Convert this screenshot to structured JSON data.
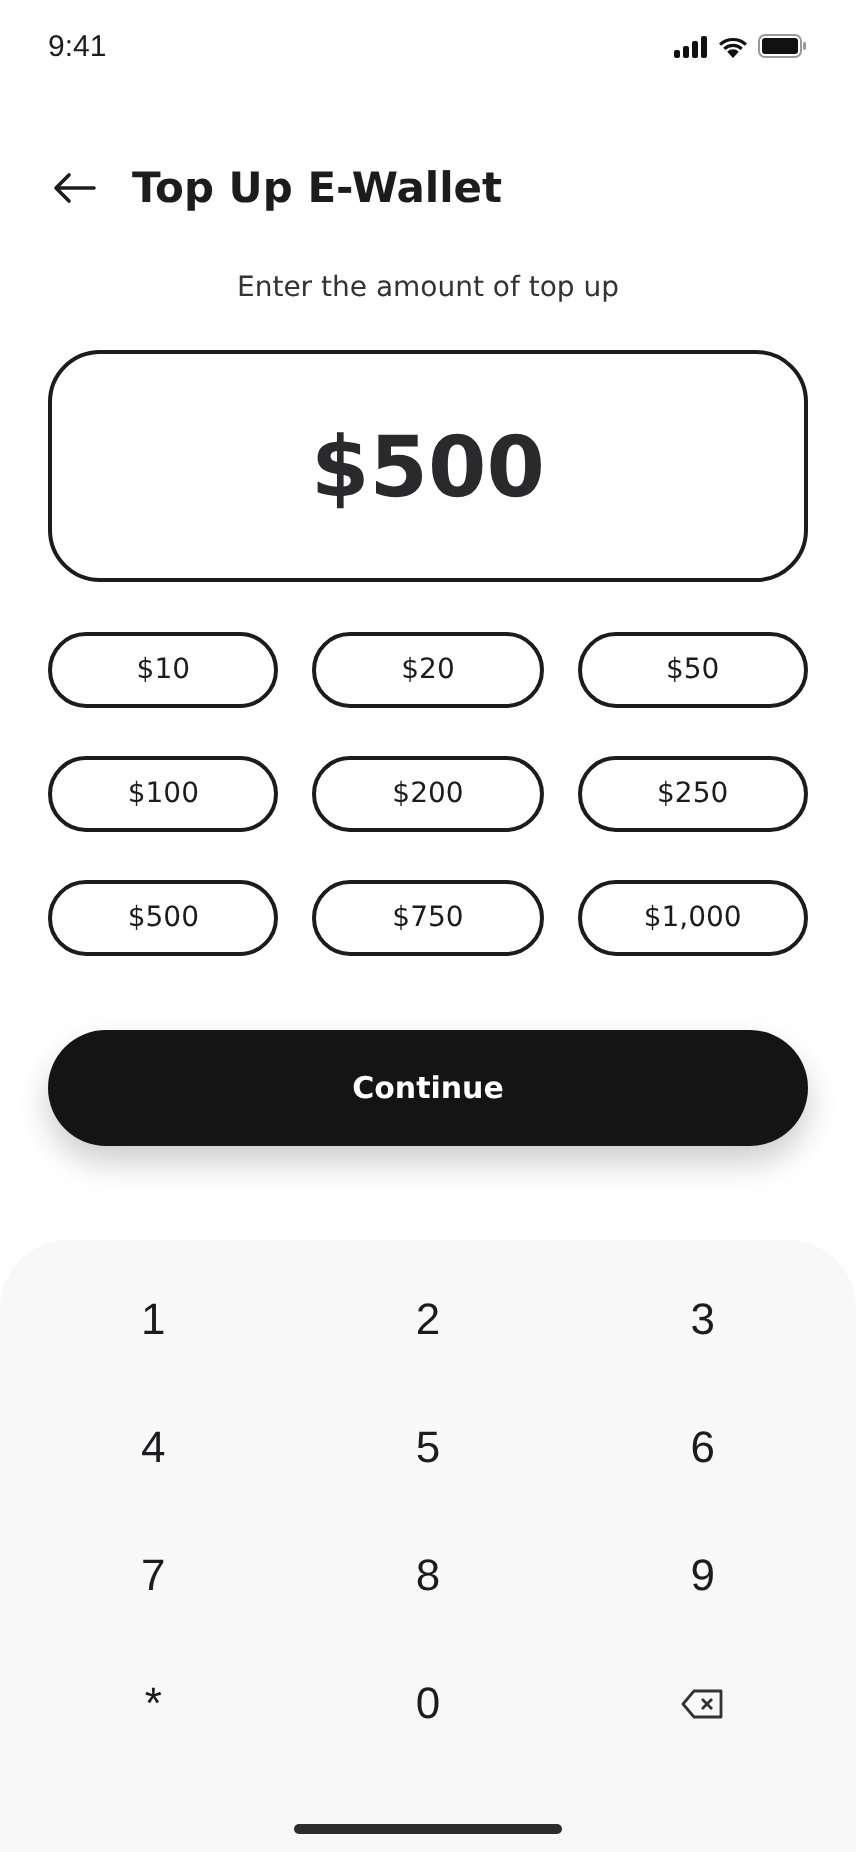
{
  "status_bar": {
    "time": "9:41"
  },
  "header": {
    "title": "Top Up E-Wallet"
  },
  "prompt": "Enter the amount of top up",
  "amount": {
    "value": "$500"
  },
  "presets": [
    "$10",
    "$20",
    "$50",
    "$100",
    "$200",
    "$250",
    "$500",
    "$750",
    "$1,000"
  ],
  "continue_button": {
    "label": "Continue"
  },
  "keypad": [
    {
      "kind": "digit",
      "label": "1"
    },
    {
      "kind": "digit",
      "label": "2"
    },
    {
      "kind": "digit",
      "label": "3"
    },
    {
      "kind": "digit",
      "label": "4"
    },
    {
      "kind": "digit",
      "label": "5"
    },
    {
      "kind": "digit",
      "label": "6"
    },
    {
      "kind": "digit",
      "label": "7"
    },
    {
      "kind": "digit",
      "label": "8"
    },
    {
      "kind": "digit",
      "label": "9"
    },
    {
      "kind": "digit",
      "label": "*"
    },
    {
      "kind": "digit",
      "label": "0"
    },
    {
      "kind": "backspace"
    }
  ]
}
